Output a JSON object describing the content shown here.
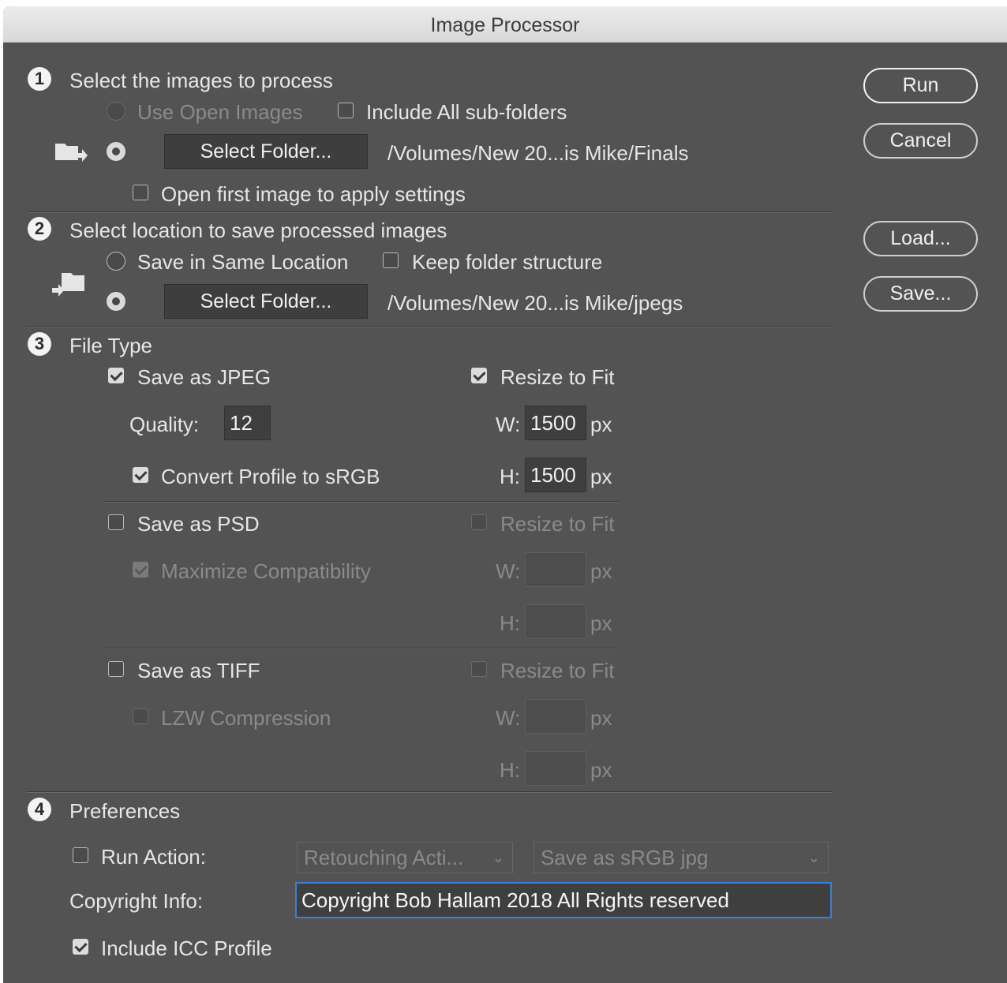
{
  "window": {
    "title": "Image Processor"
  },
  "buttons": {
    "run": "Run",
    "cancel": "Cancel",
    "load": "Load...",
    "save": "Save..."
  },
  "section1": {
    "number": "1",
    "title": "Select the images to process",
    "use_open_images": "Use Open Images",
    "include_subfolders": "Include All sub-folders",
    "select_folder": "Select Folder...",
    "path": "/Volumes/New 20...is  Mike/Finals",
    "open_first_image": "Open first image to apply settings"
  },
  "section2": {
    "number": "2",
    "title": "Select location to save processed images",
    "save_same_location": "Save in Same Location",
    "keep_folder_structure": "Keep folder structure",
    "select_folder": "Select Folder...",
    "path": "/Volumes/New 20...is  Mike/jpegs"
  },
  "section3": {
    "number": "3",
    "title": "File Type",
    "jpeg": {
      "label": "Save as JPEG",
      "resize": "Resize to Fit",
      "quality_label": "Quality:",
      "quality": "12",
      "convert_profile": "Convert Profile to sRGB",
      "w_label": "W:",
      "w": "1500",
      "h_label": "H:",
      "h": "1500",
      "unit": "px"
    },
    "psd": {
      "label": "Save as PSD",
      "resize": "Resize to Fit",
      "maximize": "Maximize Compatibility",
      "w_label": "W:",
      "h_label": "H:",
      "unit": "px"
    },
    "tiff": {
      "label": "Save as TIFF",
      "resize": "Resize to Fit",
      "lzw": "LZW Compression",
      "w_label": "W:",
      "h_label": "H:",
      "unit": "px"
    }
  },
  "section4": {
    "number": "4",
    "title": "Preferences",
    "run_action": "Run Action:",
    "action_set": "Retouching Acti...",
    "action": "Save as sRGB jpg",
    "copyright_label": "Copyright Info:",
    "copyright_value": "Copyright Bob Hallam 2018 All Rights reserved",
    "include_icc": "Include ICC Profile"
  }
}
